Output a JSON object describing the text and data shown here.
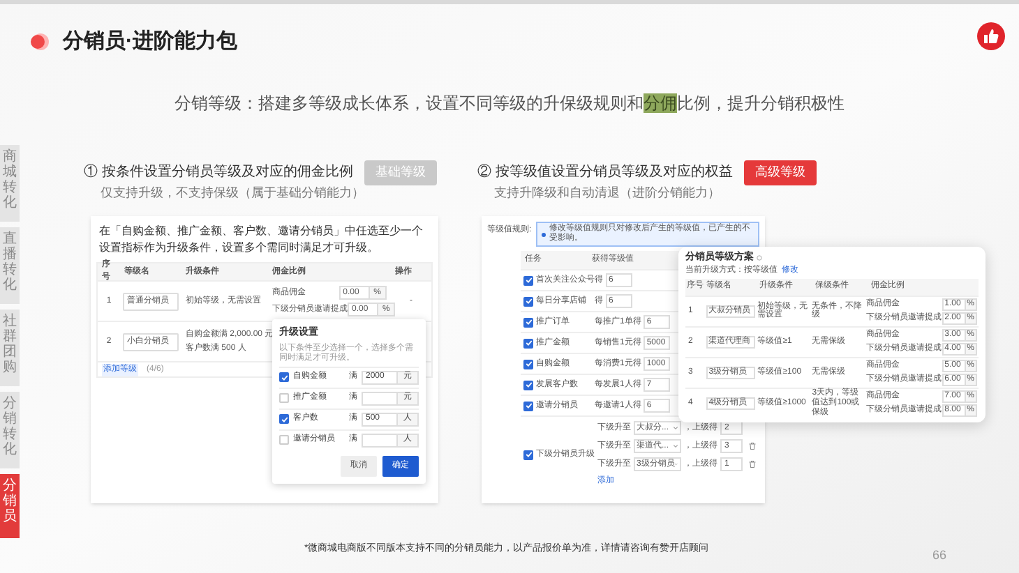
{
  "title": "分销员·进阶能力包",
  "subtitle": {
    "before": "分销等级：搭建多等级成长体系，设置不同等级的升保级规则和",
    "highlight": "分佣",
    "after": "比例，提升分销积极性"
  },
  "side_nav": [
    {
      "label": "商城转化",
      "selected": false
    },
    {
      "label": "直播转化",
      "selected": false
    },
    {
      "label": "社群团购",
      "selected": false
    },
    {
      "label": "分销转化",
      "selected": false
    },
    {
      "label": "分销员",
      "selected": true
    }
  ],
  "basic": {
    "heading": "① 按条件设置分销员等级及对应的佣金比例",
    "badge": "基础等级",
    "note": "仅支持升级，不支持保级（属于基础分销能力）",
    "intro": "在「自购金额、推广金额、客户数、邀请分销员」中任选至少一个设置指标作为升级条件，设置多个需同时满足才可升级。",
    "columns": [
      "序号",
      "等级名",
      "升级条件",
      "佣金比例",
      "操作"
    ],
    "rows": [
      {
        "no": "1",
        "name": "普通分销员",
        "conditions": [
          "初始等级，无需设置"
        ],
        "rates": [
          {
            "label": "商品佣金",
            "value": "0.00",
            "unit": "%"
          },
          {
            "label": "下级分销员邀请提成",
            "value": "0.00",
            "unit": "%"
          }
        ],
        "action": "-"
      },
      {
        "no": "2",
        "name": "小白分销员",
        "conditions": [
          "自购金额满 2,000.00 元",
          "客户数满 500 人"
        ],
        "rates": [],
        "action": ""
      }
    ],
    "add": "添加等级",
    "count": "(4/6)",
    "popup": {
      "title": "升级设置",
      "hint": "以下条件至少选择一个，选择多个需同时满足才可升级。",
      "items": [
        {
          "label": "自购金额",
          "checked": true,
          "prefix": "满",
          "value": "2000",
          "unit": "元"
        },
        {
          "label": "推广金额",
          "checked": false,
          "prefix": "满",
          "value": "",
          "unit": "元"
        },
        {
          "label": "客户数",
          "checked": true,
          "prefix": "满",
          "value": "500",
          "unit": "人"
        },
        {
          "label": "邀请分销员",
          "checked": false,
          "prefix": "满",
          "value": "",
          "unit": "人"
        }
      ],
      "buttons": [
        {
          "label": "取消",
          "kind": "secondary"
        },
        {
          "label": "确定",
          "kind": "primary"
        }
      ]
    }
  },
  "advanced": {
    "heading": "② 按等级值设置分销员等级及对应的权益",
    "badge": "高级等级",
    "note": "支持升降级和自动清退（进阶分销能力）",
    "rule_label": "等级值规则:",
    "alert": "修改等级值规则只对修改后产生的等级值，已产生的不受影响。",
    "columns": [
      "任务",
      "获得等级值"
    ],
    "tasks": [
      {
        "label": "首次关注公众号",
        "checked": true,
        "text": "得",
        "value": "6"
      },
      {
        "label": "每日分享店铺",
        "checked": true,
        "text": "得",
        "value": "6"
      },
      {
        "label": "推广订单",
        "checked": true,
        "text": "每推广1单得",
        "value": "6"
      },
      {
        "label": "推广金额",
        "checked": true,
        "text": "每销售1元得",
        "value": "5000"
      },
      {
        "label": "自购金额",
        "checked": true,
        "text": "每消费1元得",
        "value": "1000"
      },
      {
        "label": "发展客户数",
        "checked": true,
        "text": "每发展1人得",
        "value": "7"
      },
      {
        "label": "邀请分销员",
        "checked": true,
        "text": "每邀请1人得",
        "value": "6"
      }
    ],
    "sub_task": {
      "label": "下级分销员升级",
      "checked": true,
      "rules": [
        {
          "text": "下级升至",
          "level": "大叔分...",
          "text2": "，上级得",
          "value": "2",
          "deletable": false
        },
        {
          "text": "下级升至",
          "level": "渠道代...",
          "text2": "，上级得",
          "value": "3",
          "deletable": true
        },
        {
          "text": "下级升至",
          "level": "3级分销员",
          "text2": "，上级得",
          "value": "1",
          "deletable": true
        }
      ],
      "add": "添加"
    },
    "plan": {
      "title": "分销员等级方案",
      "mode": "当前升级方式：按等级值",
      "edit": "修改",
      "columns": [
        "序号",
        "等级名",
        "升级条件",
        "保级条件",
        "佣金比例"
      ],
      "rows": [
        {
          "no": "1",
          "name": "大叔分销员",
          "upgrade": "初始等级，无需设置",
          "keep": "无条件，不降级",
          "rates": [
            {
              "label": "商品佣金",
              "value": "1.00"
            },
            {
              "label": "下级分销员邀请提成",
              "value": "2.00"
            }
          ]
        },
        {
          "no": "2",
          "name": "渠道代理商",
          "upgrade": "等级值≥1",
          "keep": "无需保级",
          "rates": [
            {
              "label": "商品佣金",
              "value": "3.00"
            },
            {
              "label": "下级分销员邀请提成",
              "value": "4.00"
            }
          ]
        },
        {
          "no": "3",
          "name": "3级分销员",
          "upgrade": "等级值≥100",
          "keep": "无需保级",
          "rates": [
            {
              "label": "商品佣金",
              "value": "5.00"
            },
            {
              "label": "下级分销员邀请提成",
              "value": "6.00"
            }
          ]
        },
        {
          "no": "4",
          "name": "4级分销员",
          "upgrade": "等级值≥1000",
          "keep": "3天内，等级值达到100或保级",
          "rates": [
            {
              "label": "商品佣金",
              "value": "7.00"
            },
            {
              "label": "下级分销员邀请提成",
              "value": "8.00"
            }
          ]
        }
      ],
      "unit": "%"
    }
  },
  "footnote": "*微商城电商版不同版本支持不同的分销员能力，以产品报价单为准，详情请咨询有赞开店顾问",
  "page_number": "66"
}
